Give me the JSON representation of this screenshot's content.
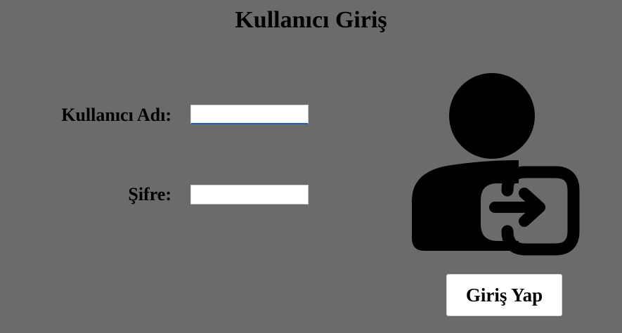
{
  "page": {
    "title": "Kullanıcı Giriş"
  },
  "form": {
    "username_label": "Kullanıcı Adı:",
    "username_value": "",
    "password_label": "Şifre:",
    "password_value": "",
    "submit_label": "Giriş Yap"
  },
  "icon": {
    "name": "user-login-icon"
  },
  "colors": {
    "background": "#6b6b6b",
    "focus_border": "#1f5fae"
  }
}
